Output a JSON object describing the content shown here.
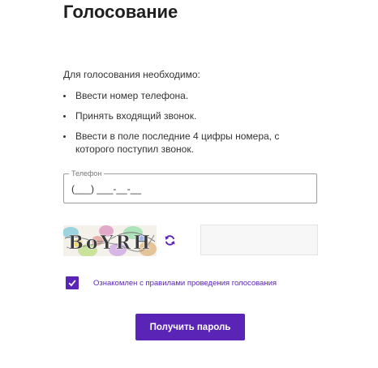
{
  "page": {
    "title": "Голосование",
    "intro": "Для голосования необходимо:",
    "steps": [
      "Ввести номер телефона.",
      "Принять входящий звонок.",
      "Ввести в поле последние 4 цифры номера, с которого поступил звонок."
    ]
  },
  "phone": {
    "legend": "Телефон",
    "placeholder": "(___) ___-__-__"
  },
  "captcha": {
    "text": "BoYRH",
    "refresh_icon": "refresh-icon"
  },
  "agreement": {
    "checked": true,
    "label": "Ознакомлен с правилами проведения голосования"
  },
  "submit": {
    "label": "Получить пароль"
  },
  "colors": {
    "accent": "#5a25b7",
    "text": "#333333",
    "title": "#1f1f1f"
  }
}
